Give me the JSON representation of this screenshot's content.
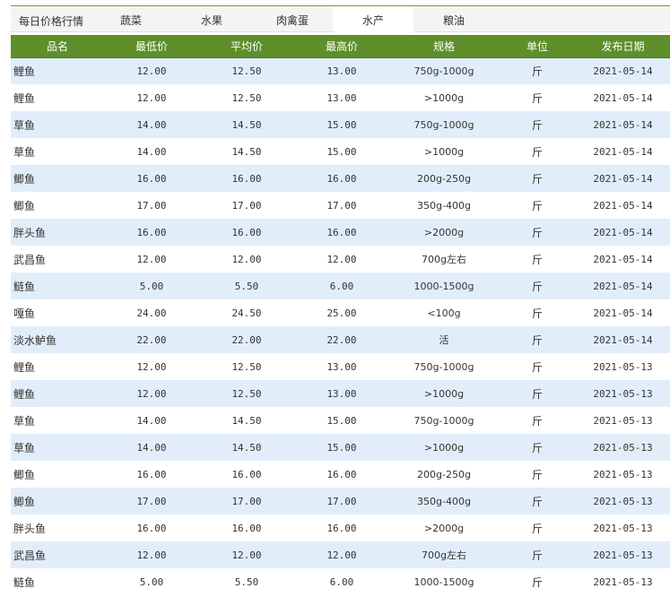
{
  "tabs": {
    "title": "每日价格行情",
    "items": [
      {
        "label": "蔬菜",
        "active": false
      },
      {
        "label": "水果",
        "active": false
      },
      {
        "label": "肉禽蛋",
        "active": false
      },
      {
        "label": "水产",
        "active": true
      },
      {
        "label": "粮油",
        "active": false
      }
    ]
  },
  "colors": {
    "header_green": "#5e8f2a",
    "row_blue": "#e1eefa",
    "accent_line": "#6a9f3a"
  },
  "table": {
    "headers": [
      "品名",
      "最低价",
      "平均价",
      "最高价",
      "规格",
      "单位",
      "发布日期"
    ],
    "rows": [
      [
        "鲤鱼",
        "12.00",
        "12.50",
        "13.00",
        "750g-1000g",
        "斤",
        "2021-05-14"
      ],
      [
        "鲤鱼",
        "12.00",
        "12.50",
        "13.00",
        ">1000g",
        "斤",
        "2021-05-14"
      ],
      [
        "草鱼",
        "14.00",
        "14.50",
        "15.00",
        "750g-1000g",
        "斤",
        "2021-05-14"
      ],
      [
        "草鱼",
        "14.00",
        "14.50",
        "15.00",
        ">1000g",
        "斤",
        "2021-05-14"
      ],
      [
        "鲫鱼",
        "16.00",
        "16.00",
        "16.00",
        "200g-250g",
        "斤",
        "2021-05-14"
      ],
      [
        "鲫鱼",
        "17.00",
        "17.00",
        "17.00",
        "350g-400g",
        "斤",
        "2021-05-14"
      ],
      [
        "胖头鱼",
        "16.00",
        "16.00",
        "16.00",
        ">2000g",
        "斤",
        "2021-05-14"
      ],
      [
        "武昌鱼",
        "12.00",
        "12.00",
        "12.00",
        "700g左右",
        "斤",
        "2021-05-14"
      ],
      [
        "鲢鱼",
        "5.00",
        "5.50",
        "6.00",
        "1000-1500g",
        "斤",
        "2021-05-14"
      ],
      [
        "嘎鱼",
        "24.00",
        "24.50",
        "25.00",
        "<100g",
        "斤",
        "2021-05-14"
      ],
      [
        "淡水鲈鱼",
        "22.00",
        "22.00",
        "22.00",
        "活",
        "斤",
        "2021-05-14"
      ],
      [
        "鲤鱼",
        "12.00",
        "12.50",
        "13.00",
        "750g-1000g",
        "斤",
        "2021-05-13"
      ],
      [
        "鲤鱼",
        "12.00",
        "12.50",
        "13.00",
        ">1000g",
        "斤",
        "2021-05-13"
      ],
      [
        "草鱼",
        "14.00",
        "14.50",
        "15.00",
        "750g-1000g",
        "斤",
        "2021-05-13"
      ],
      [
        "草鱼",
        "14.00",
        "14.50",
        "15.00",
        ">1000g",
        "斤",
        "2021-05-13"
      ],
      [
        "鲫鱼",
        "16.00",
        "16.00",
        "16.00",
        "200g-250g",
        "斤",
        "2021-05-13"
      ],
      [
        "鲫鱼",
        "17.00",
        "17.00",
        "17.00",
        "350g-400g",
        "斤",
        "2021-05-13"
      ],
      [
        "胖头鱼",
        "16.00",
        "16.00",
        "16.00",
        ">2000g",
        "斤",
        "2021-05-13"
      ],
      [
        "武昌鱼",
        "12.00",
        "12.00",
        "12.00",
        "700g左右",
        "斤",
        "2021-05-13"
      ],
      [
        "鲢鱼",
        "5.00",
        "5.50",
        "6.00",
        "1000-1500g",
        "斤",
        "2021-05-13"
      ]
    ]
  }
}
